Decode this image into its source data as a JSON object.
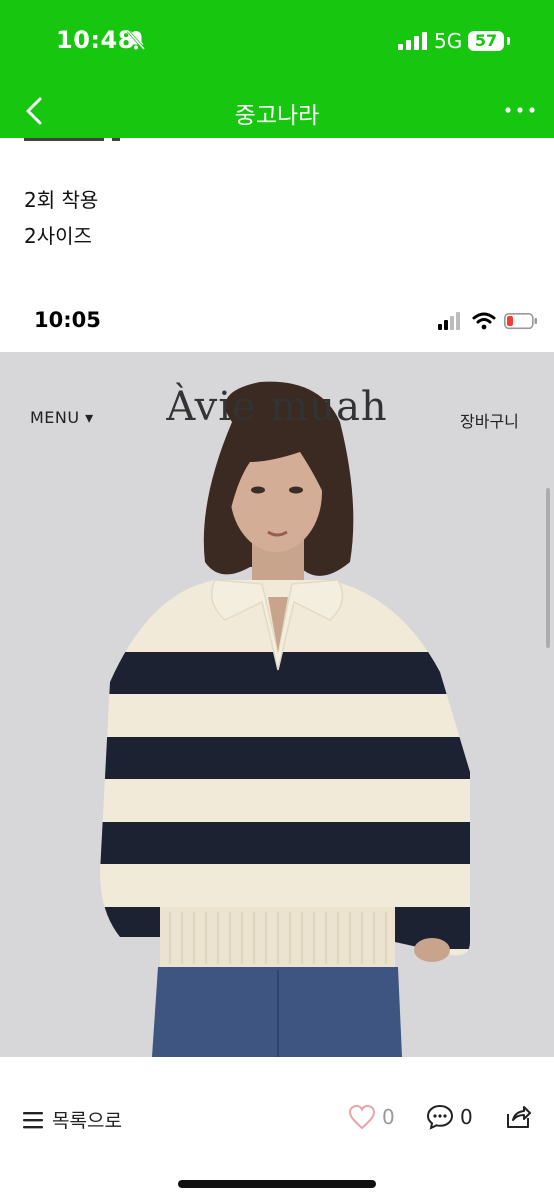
{
  "status_bar": {
    "time": "10:48",
    "network": "5G",
    "battery": "57"
  },
  "nav": {
    "title": "중고나라"
  },
  "description": {
    "line1": "2회 착용",
    "line2": "2사이즈"
  },
  "screenshot_image": {
    "status_time": "10:05",
    "menu_label": "MENU ▾",
    "brand": "Àvie muah",
    "cart_label": "장바구니"
  },
  "bottom_bar": {
    "list_label": "목록으로",
    "like_count": "0",
    "comment_count": "0"
  },
  "colors": {
    "brand_green": "#16c60f",
    "sweater_navy": "#1d2233",
    "sweater_cream": "#f1ead8"
  }
}
